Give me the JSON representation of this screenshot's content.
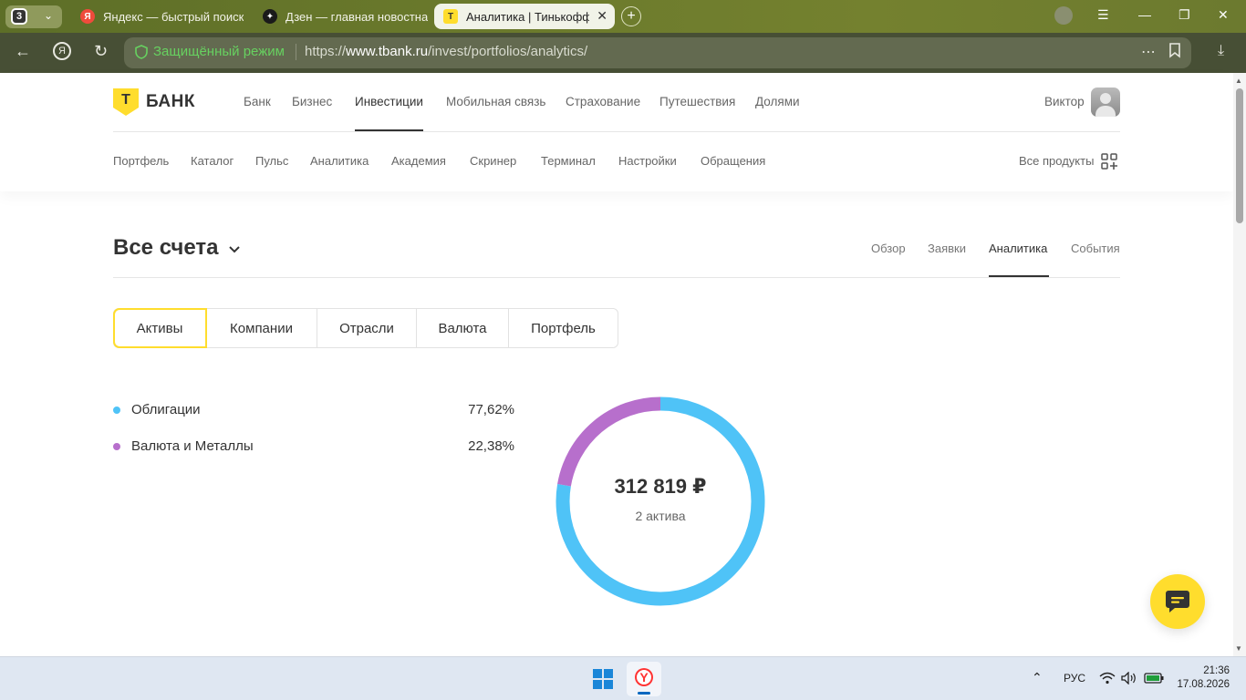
{
  "browser": {
    "tab_count": "3",
    "tabs": [
      {
        "title": "Яндекс — быстрый поиск",
        "favicon": "yandex-icon",
        "color": "#f04b3c"
      },
      {
        "title": "Дзен — главная новостна",
        "favicon": "dzen-icon",
        "color": "#1a1a1a"
      },
      {
        "title": "Аналитика | Тинькофф",
        "favicon": "tbank-icon",
        "active": true
      }
    ],
    "secure_label": "Защищённый режим",
    "url_prefix": "https://",
    "url_domain": "www.tbank.ru",
    "url_path": "/invest/portfolios/analytics/"
  },
  "site": {
    "logo_letter": "Т",
    "logo_text": "БАНК",
    "top_nav": [
      "Банк",
      "Бизнес",
      "Инвестиции",
      "Мобильная связь",
      "Страхование",
      "Путешествия",
      "Долями"
    ],
    "top_nav_active": "Инвестиции",
    "user_name": "Виктор",
    "sub_nav": [
      "Портфель",
      "Каталог",
      "Пульс",
      "Аналитика",
      "Академия",
      "Скринер",
      "Терминал",
      "Настройки",
      "Обращения"
    ],
    "all_products": "Все продукты"
  },
  "page": {
    "title": "Все счета",
    "right_tabs": [
      "Обзор",
      "Заявки",
      "Аналитика",
      "События"
    ],
    "right_tab_active": "Аналитика",
    "segments": [
      "Активы",
      "Компании",
      "Отрасли",
      "Валюта",
      "Портфель"
    ],
    "segment_active": "Активы"
  },
  "chart_data": {
    "type": "pie",
    "categories": [
      "Облигации",
      "Валюта и Металлы"
    ],
    "values": [
      77.62,
      22.38
    ],
    "value_labels": [
      "77,62%",
      "22,38%"
    ],
    "colors": [
      "#4fc3f7",
      "#b76fcc"
    ],
    "center_total": "312 819 ₽",
    "center_caption": "2 актива"
  },
  "accent_color": "#ffdd2d",
  "taskbar": {
    "lang": "РУС",
    "time": "21:36",
    "date": "17.08.2026"
  }
}
